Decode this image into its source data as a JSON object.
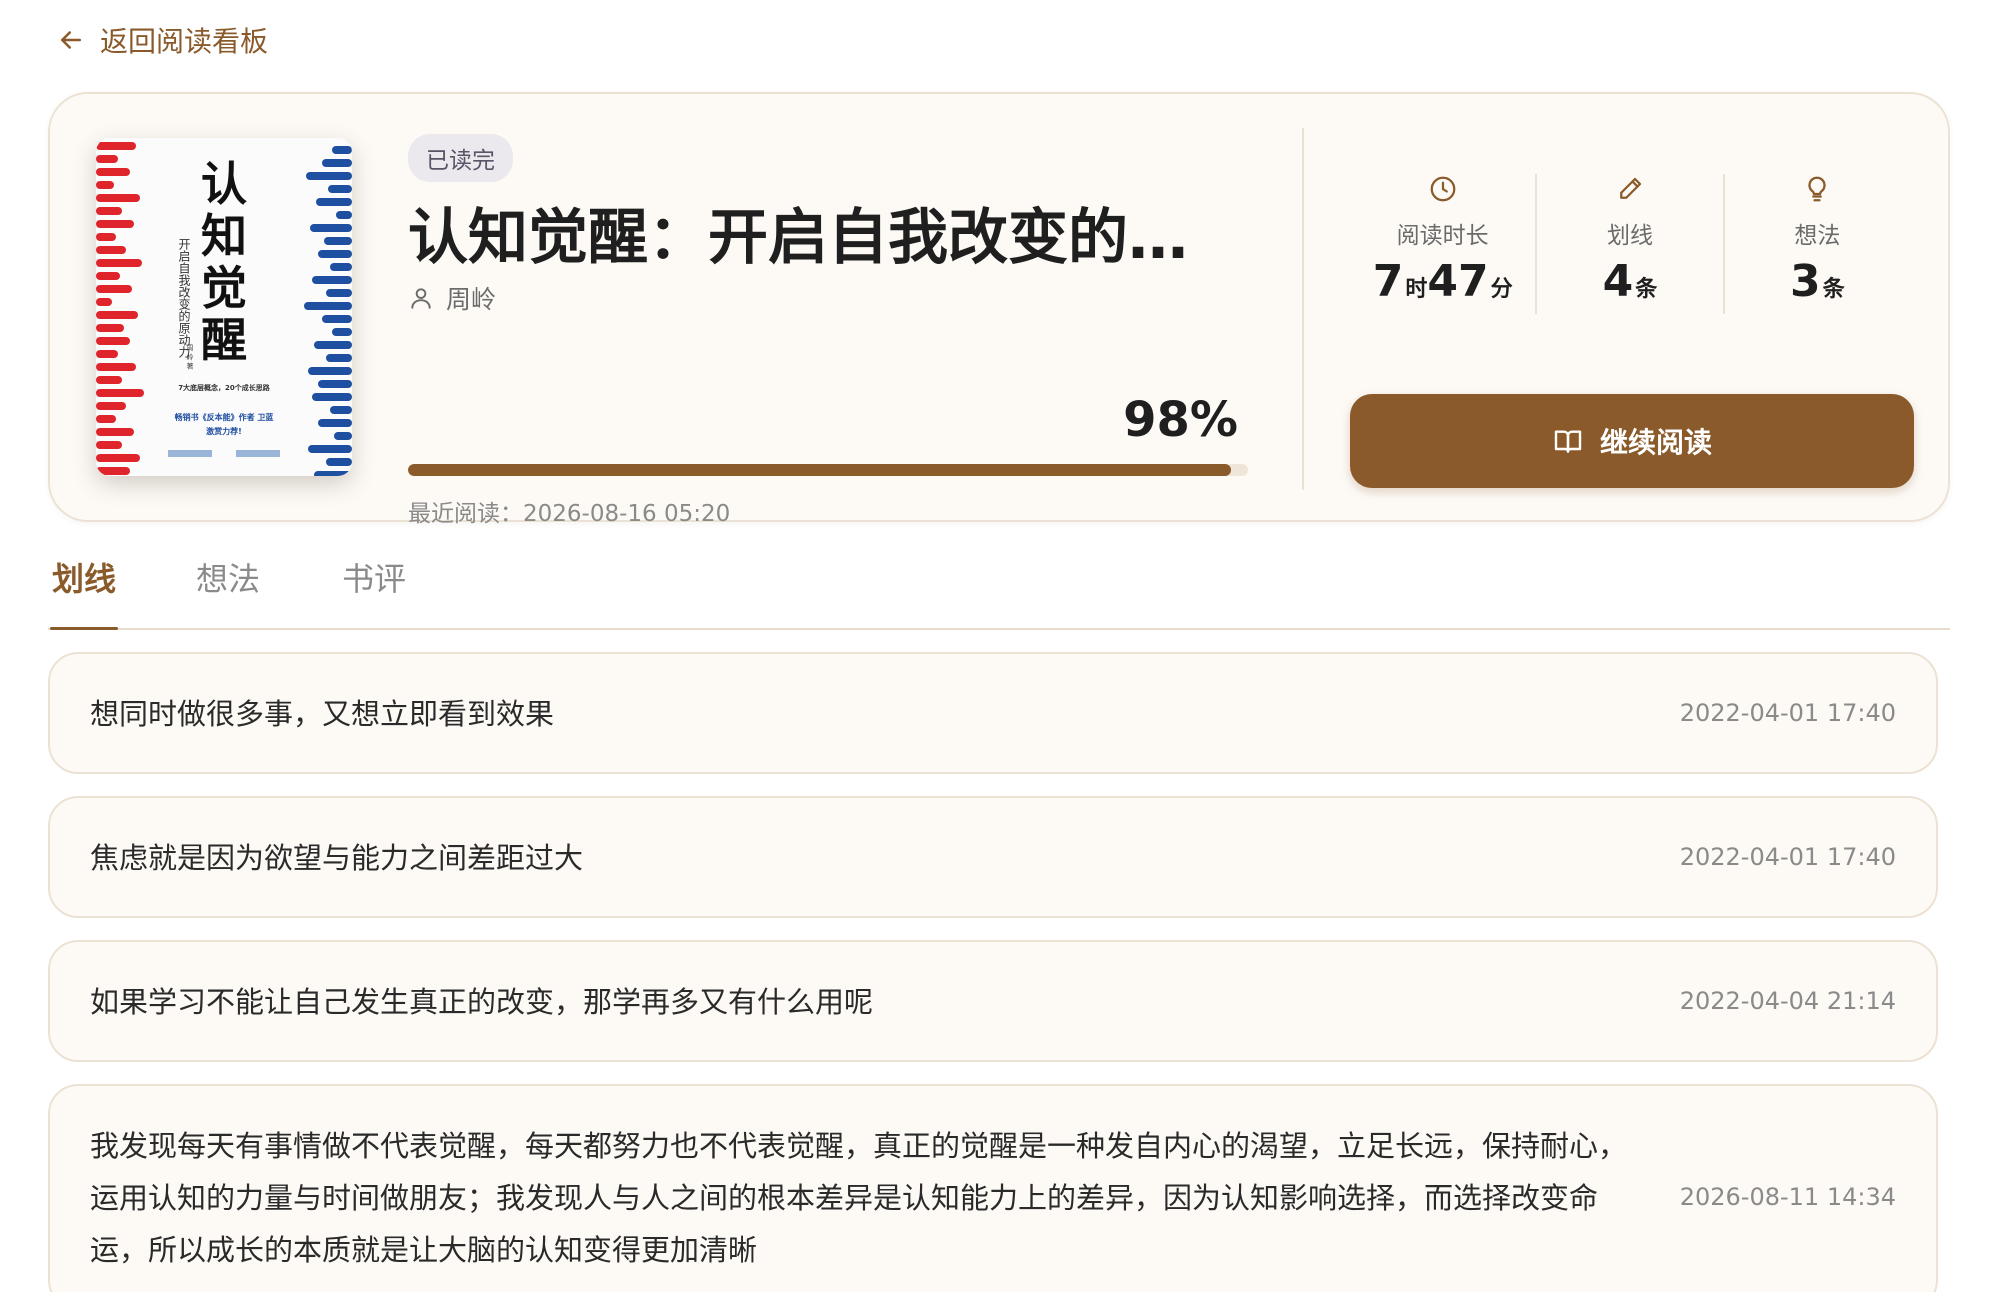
{
  "nav": {
    "back_label": "返回阅读看板"
  },
  "book": {
    "status": "已读完",
    "title": "认知觉醒：开启自我改变的原动力",
    "author": "周岭",
    "progress_percent": 98,
    "progress_label": "98%",
    "last_read_label": "最近阅读：",
    "last_read_time": "2026-08-16 05:20",
    "cover": {
      "title_chars": [
        "认",
        "知",
        "觉",
        "醒"
      ],
      "subtitle": "开启自我改变的原动力",
      "author": "周 岭 著",
      "tagline": "7大底层概念，20个成长思路",
      "promo_line1": "畅销书《反本能》作者 卫蓝",
      "promo_line2": "激赏力荐!"
    }
  },
  "stats": [
    {
      "icon": "clock-icon",
      "label": "阅读时长",
      "parts": [
        {
          "num": "7",
          "unit": "时"
        },
        {
          "num": "47",
          "unit": "分"
        }
      ]
    },
    {
      "icon": "pencil-icon",
      "label": "划线",
      "parts": [
        {
          "num": "4",
          "unit": "条"
        }
      ]
    },
    {
      "icon": "lightbulb-icon",
      "label": "想法",
      "parts": [
        {
          "num": "3",
          "unit": "条"
        }
      ]
    }
  ],
  "actions": {
    "continue_label": "继续阅读"
  },
  "tabs": [
    {
      "label": "划线",
      "active": true
    },
    {
      "label": "想法",
      "active": false
    },
    {
      "label": "书评",
      "active": false
    }
  ],
  "highlights": [
    {
      "text": "想同时做很多事，又想立即看到效果",
      "date": "2022-04-01 17:40"
    },
    {
      "text": "焦虑就是因为欲望与能力之间差距过大",
      "date": "2022-04-01 17:40"
    },
    {
      "text": "如果学习不能让自己发生真正的改变，那学再多又有什么用呢",
      "date": "2022-04-04 21:14"
    },
    {
      "text": "我发现每天有事情做不代表觉醒，每天都努力也不代表觉醒，真正的觉醒是一种发自内心的渴望，立足长远，保持耐心，运用认知的力量与时间做朋友；我发现人与人之间的根本差异是认知能力上的差异，因为认知影响选择，而选择改变命运，所以成长的本质就是让大脑的认知变得更加清晰",
      "date": "2026-08-11 14:34"
    }
  ],
  "colors": {
    "accent": "#8a5a2b",
    "card_bg": "#fdfaf6",
    "border": "#ece2d4",
    "cover_red": "#e0242b",
    "cover_blue": "#1f4fa0"
  }
}
